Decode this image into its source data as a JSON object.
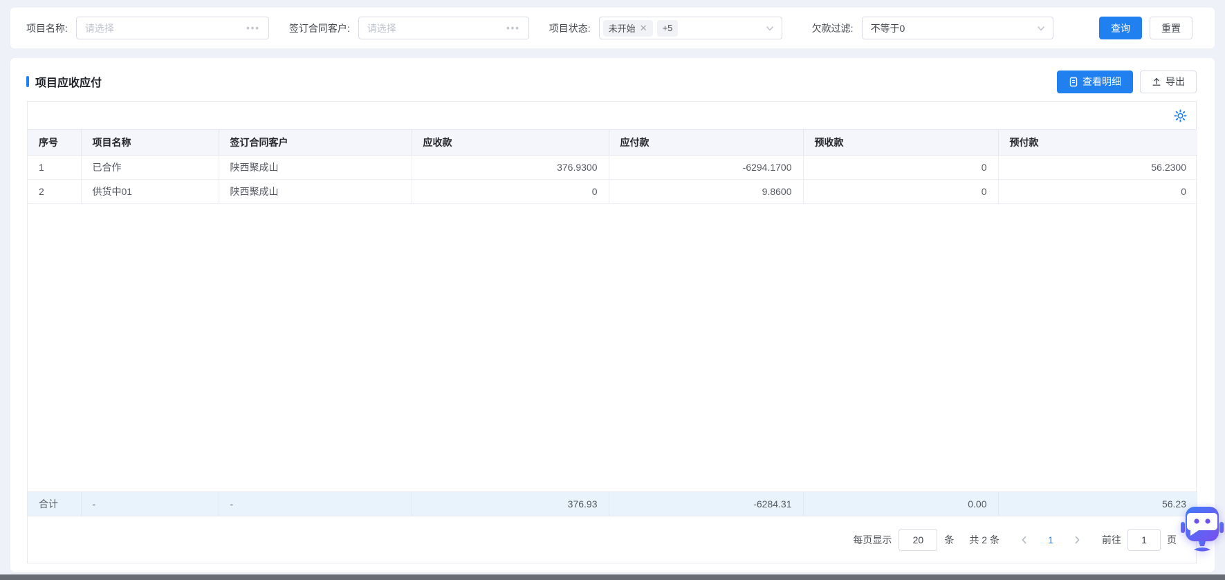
{
  "filters": {
    "project_name": {
      "label": "项目名称:",
      "placeholder": "请选择"
    },
    "contract_customer": {
      "label": "签订合同客户:",
      "placeholder": "请选择"
    },
    "project_status": {
      "label": "项目状态:",
      "tag": "未开始",
      "more_count": "+5"
    },
    "debt_filter": {
      "label": "欠款过滤:",
      "value": "不等于0"
    },
    "search_label": "查询",
    "reset_label": "重置"
  },
  "panel": {
    "title": "项目应收应付",
    "view_detail_label": "查看明细",
    "export_label": "导出"
  },
  "table": {
    "columns": [
      "序号",
      "项目名称",
      "签订合同客户",
      "应收款",
      "应付款",
      "预收款",
      "预付款"
    ],
    "rows": [
      [
        "1",
        "已合作",
        "陕西聚成山",
        "376.9300",
        "-6294.1700",
        "0",
        "56.2300"
      ],
      [
        "2",
        "供货中01",
        "陕西聚成山",
        "0",
        "9.8600",
        "0",
        "0"
      ]
    ],
    "summary": [
      "合计",
      "-",
      "-",
      "376.93",
      "-6284.31",
      "0.00",
      "56.23"
    ]
  },
  "pagination": {
    "page_size_label": "每页显示",
    "page_size": "20",
    "unit_label": "条",
    "total_label": "共 2 条",
    "current_page": "1",
    "goto_label": "前往",
    "goto_value": "1",
    "page_label": "页"
  },
  "colors": {
    "accent": "#2080f0",
    "page_bg": "#eef1f8",
    "header_bg": "#f4f6fb",
    "summary_row_bg": "#e9f3fc",
    "robot_gradient_start": "#3f7bf8",
    "robot_gradient_end": "#7a4ff0"
  }
}
